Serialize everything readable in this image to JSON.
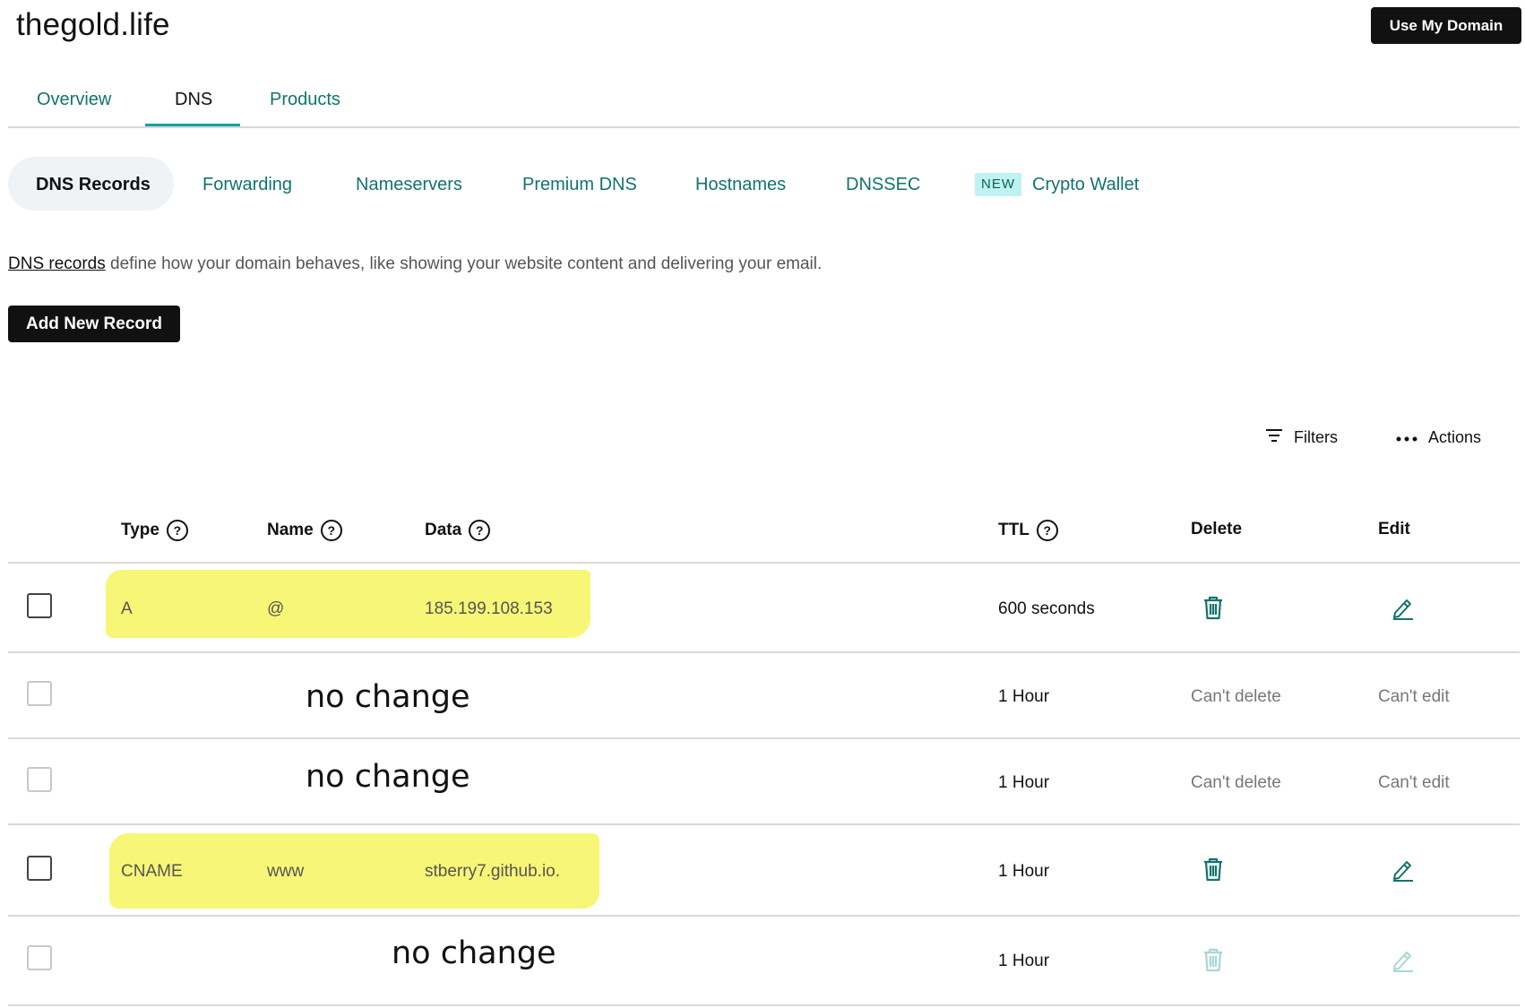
{
  "header": {
    "domain": "thegold.life",
    "use_domain_label": "Use My Domain"
  },
  "main_tabs": [
    {
      "label": "Overview",
      "active": false
    },
    {
      "label": "DNS",
      "active": true
    },
    {
      "label": "Products",
      "active": false
    }
  ],
  "sub_tabs": [
    {
      "label": "DNS Records",
      "active": true
    },
    {
      "label": "Forwarding"
    },
    {
      "label": "Nameservers"
    },
    {
      "label": "Premium DNS"
    },
    {
      "label": "Hostnames"
    },
    {
      "label": "DNSSEC"
    },
    {
      "label": "Crypto Wallet",
      "badge": "NEW"
    }
  ],
  "description": {
    "link_text": "DNS records",
    "text": "define how your domain behaves, like showing your website content and delivering your email."
  },
  "add_record_label": "Add New Record",
  "toolbar": {
    "filters_label": "Filters",
    "actions_label": "Actions"
  },
  "table": {
    "columns": [
      "Type",
      "Name",
      "Data",
      "TTL",
      "Delete",
      "Edit"
    ],
    "rows": [
      {
        "type": "A",
        "name": "@",
        "data": "185.199.108.153",
        "ttl": "600 seconds",
        "delete": "icon",
        "edit": "icon",
        "highlighted": true
      },
      {
        "note": "no change",
        "ttl": "1 Hour",
        "delete": "Can't delete",
        "edit": "Can't edit"
      },
      {
        "note": "no change",
        "ttl": "1 Hour",
        "delete": "Can't delete",
        "edit": "Can't edit"
      },
      {
        "type": "CNAME",
        "name": "www",
        "data": "stberry7.github.io.",
        "ttl": "1 Hour",
        "delete": "icon",
        "edit": "icon",
        "highlighted": true
      },
      {
        "note": "no change",
        "ttl": "1 Hour",
        "delete": "icon-disabled",
        "edit": "icon-disabled"
      }
    ]
  },
  "colors": {
    "accent": "#11736e",
    "tab_underline": "#11a3a3",
    "highlight": "#f7f56a",
    "button_bg": "#111111"
  }
}
